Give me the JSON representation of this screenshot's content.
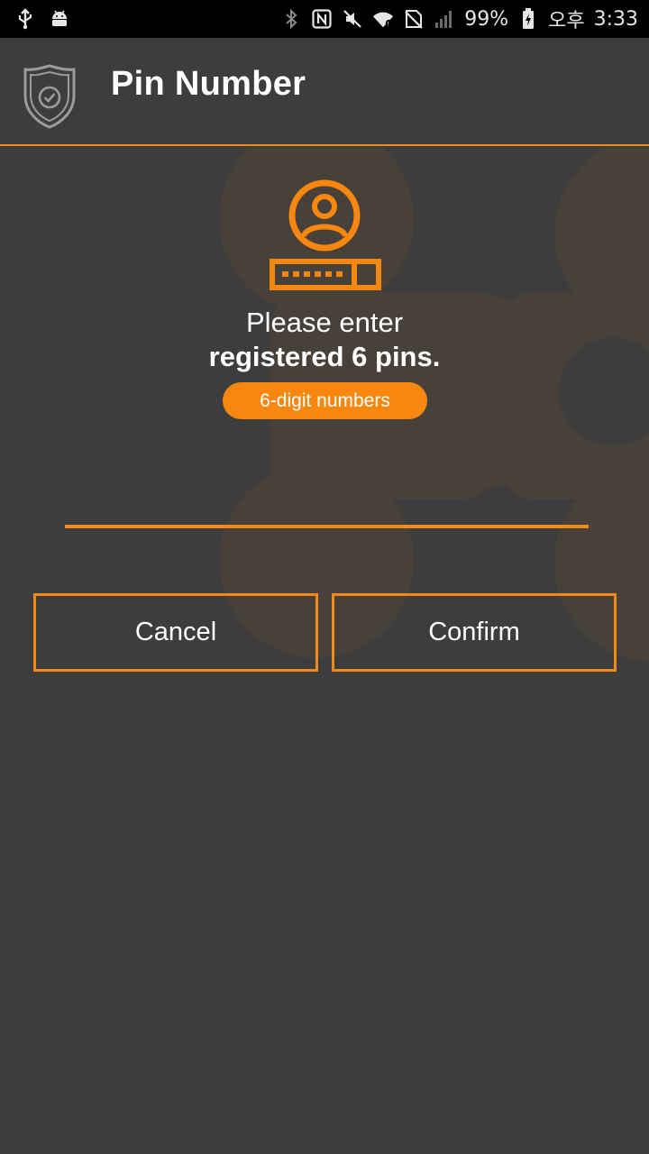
{
  "status_bar": {
    "battery_percent": "99%",
    "ampm": "오후",
    "time": "3:33"
  },
  "header": {
    "title": "Pin Number"
  },
  "main": {
    "prompt_line1": "Please enter",
    "prompt_line2": "registered 6 pins.",
    "hint": "6-digit numbers",
    "pin_value": ""
  },
  "buttons": {
    "cancel": "Cancel",
    "confirm": "Confirm"
  },
  "colors": {
    "accent": "#f08a18",
    "background": "#3d3d3d",
    "status_bar": "#000000"
  },
  "icons": [
    "usb-icon",
    "android-icon",
    "bluetooth-icon",
    "nfc-icon",
    "mute-icon",
    "wifi-icon",
    "no-sim-icon",
    "signal-icon",
    "battery-icon",
    "shield-check-icon",
    "user-device-icon"
  ]
}
